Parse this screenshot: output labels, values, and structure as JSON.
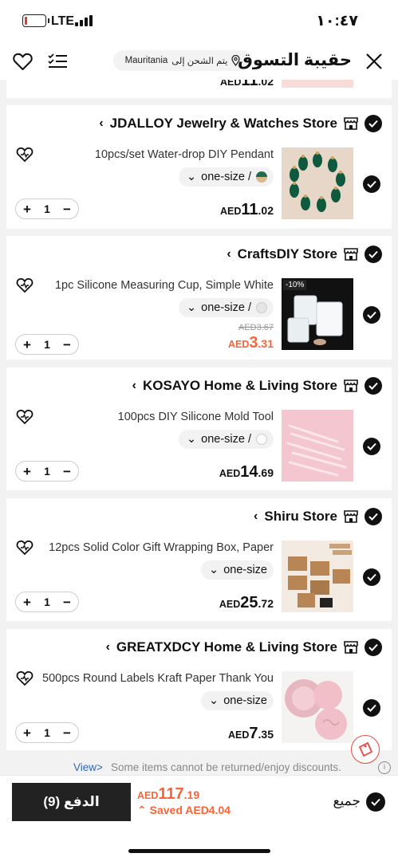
{
  "status_bar": {
    "network": "LTE",
    "time": "١٠:٤٧"
  },
  "header": {
    "title": "حقيبة التسوق",
    "shipping_prefix": "يتم الشحن إلى",
    "shipping_country": "Mauritania"
  },
  "partial_item": {
    "price_currency": "AED",
    "price_int": "11",
    "price_dec": ".02"
  },
  "stores": [
    {
      "name": "JDALLOY Jewelry & Watches Store",
      "item": {
        "title": "10pcs/set Water-drop DIY Pendant",
        "variant": "one-size /",
        "quantity": "1",
        "price_currency": "AED",
        "price_int": "11",
        "price_dec": ".02",
        "thumb": "green-pendants"
      }
    },
    {
      "name": "CraftsDIY Store",
      "item": {
        "title": "1pc Silicone Measuring Cup, Simple White",
        "variant": "one-size /",
        "quantity": "1",
        "old_price": "AED3.67",
        "price_currency": "AED",
        "price_int": "3",
        "price_dec": ".31",
        "discount_badge": "-10%",
        "thumb": "measuring-cups"
      }
    },
    {
      "name": "KOSAYO Home & Living Store",
      "item": {
        "title": "100pcs DIY Silicone Mold Tool",
        "variant": "one-size /",
        "quantity": "1",
        "price_currency": "AED",
        "price_int": "14",
        "price_dec": ".69",
        "thumb": "pink-droppers"
      }
    },
    {
      "name": "Shiru Store",
      "item": {
        "title": "12pcs Solid Color Gift Wrapping Box, Paper",
        "variant": "one-size",
        "quantity": "1",
        "price_currency": "AED",
        "price_int": "25",
        "price_dec": ".72",
        "thumb": "kraft-boxes"
      }
    },
    {
      "name": "GREATXDCY Home & Living Store",
      "item": {
        "title": "500pcs Round Labels Kraft Paper Thank You",
        "variant": "one-size",
        "quantity": "1",
        "price_currency": "AED",
        "price_int": "7",
        "price_dec": ".35",
        "thumb": "thank-you-labels"
      }
    }
  ],
  "notice": {
    "link": "View>",
    "text": "Some items cannot be returned/enjoy discounts."
  },
  "bottom_bar": {
    "pay_label": "الدفع (9)",
    "total_currency": "AED",
    "total_int": "117",
    "total_dec": ".19",
    "saved_label": "Saved AED4.04",
    "select_all_label": "جميع"
  },
  "colors": {
    "accent": "#fa6338",
    "dark": "#222222",
    "link": "#2d6cb5"
  }
}
